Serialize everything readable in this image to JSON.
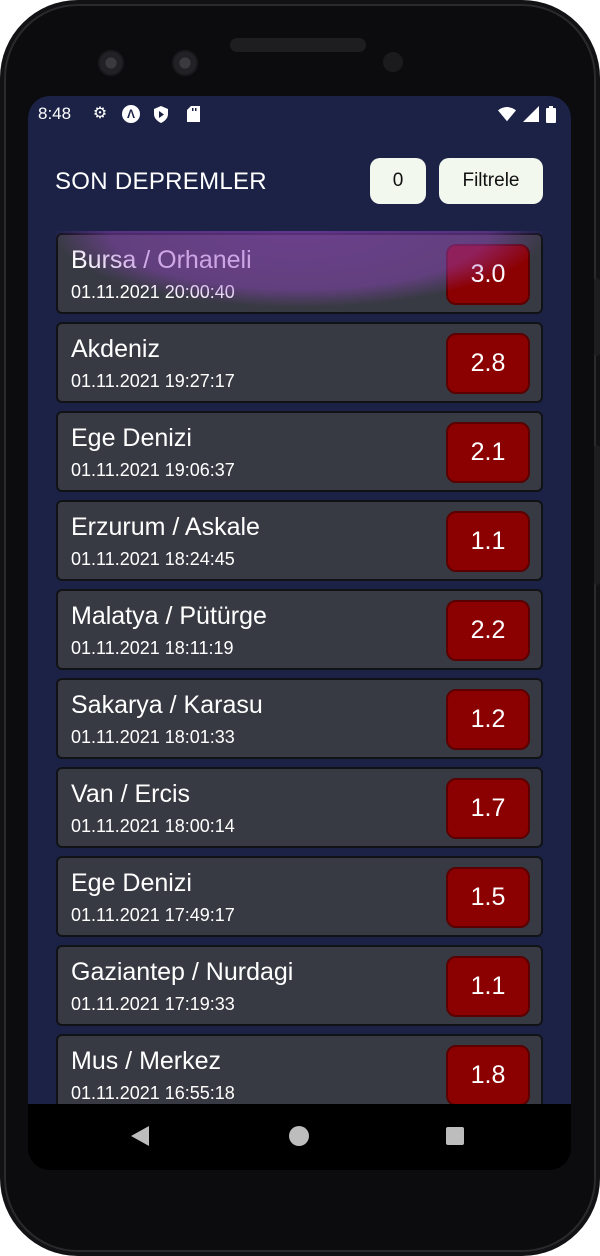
{
  "status_bar": {
    "time": "8:48",
    "icons": [
      "gear-icon",
      "a-icon",
      "shield-icon",
      "sd-card-icon",
      "wifi-icon",
      "signal-icon",
      "battery-icon"
    ]
  },
  "toolbar": {
    "title": "SON DEPREMLER",
    "count": "0",
    "filter_label": "Filtrele"
  },
  "colors": {
    "background": "#1b2246",
    "card": "#373a42",
    "magnitude_badge": "#8b0000",
    "button": "#f2f8ee",
    "ripple": "#9646c8"
  },
  "earthquakes": [
    {
      "place": "Bursa / Orhaneli",
      "datetime": "01.11.2021 20:00:40",
      "magnitude": "3.0"
    },
    {
      "place": "Akdeniz",
      "datetime": "01.11.2021 19:27:17",
      "magnitude": "2.8"
    },
    {
      "place": "Ege Denizi",
      "datetime": "01.11.2021 19:06:37",
      "magnitude": "2.1"
    },
    {
      "place": "Erzurum / Askale",
      "datetime": "01.11.2021 18:24:45",
      "magnitude": "1.1"
    },
    {
      "place": "Malatya / Pütürge",
      "datetime": "01.11.2021 18:11:19",
      "magnitude": "2.2"
    },
    {
      "place": "Sakarya / Karasu",
      "datetime": "01.11.2021 18:01:33",
      "magnitude": "1.2"
    },
    {
      "place": "Van / Ercis",
      "datetime": "01.11.2021 18:00:14",
      "magnitude": "1.7"
    },
    {
      "place": "Ege Denizi",
      "datetime": "01.11.2021 17:49:17",
      "magnitude": "1.5"
    },
    {
      "place": "Gaziantep / Nurdagi",
      "datetime": "01.11.2021 17:19:33",
      "magnitude": "1.1"
    },
    {
      "place": "Mus / Merkez",
      "datetime": "01.11.2021 16:55:18",
      "magnitude": "1.8"
    }
  ]
}
